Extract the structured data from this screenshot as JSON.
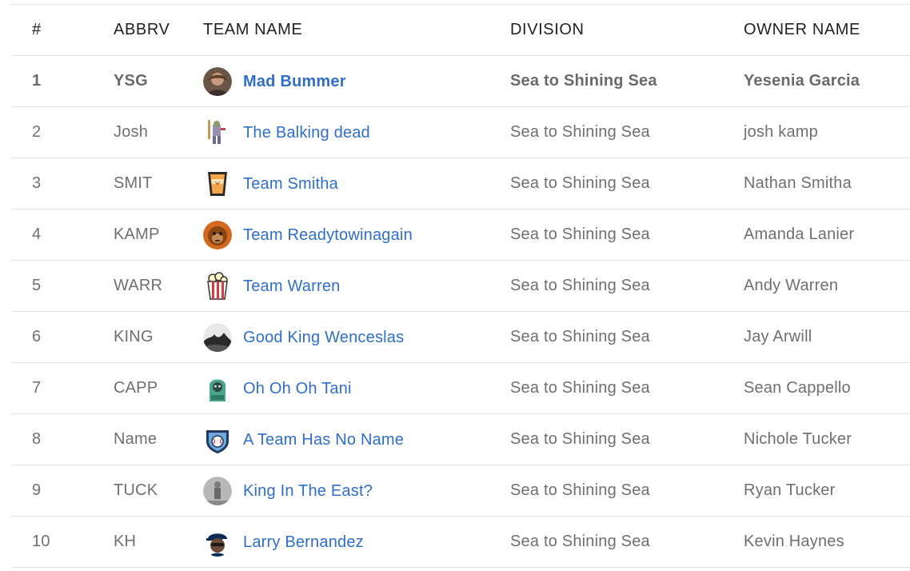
{
  "columns": {
    "rank": "#",
    "abbrv": "ABBRV",
    "team_name": "TEAM NAME",
    "division": "DIVISION",
    "owner_name": "OWNER NAME"
  },
  "colors": {
    "link": "#2f6fc6",
    "text": "#6f6f6f",
    "header_text": "#222222",
    "divider": "#e6e6e6"
  },
  "rows": [
    {
      "rank": "1",
      "abbr": "YSG",
      "team": "Mad Bummer",
      "division": "Sea to Shining Sea",
      "owner": "Yesenia Garcia",
      "avatar": "photo-avatar"
    },
    {
      "rank": "2",
      "abbr": "Josh",
      "team": "The Balking dead",
      "division": "Sea to Shining Sea",
      "owner": "josh kamp",
      "avatar": "zombie-avatar"
    },
    {
      "rank": "3",
      "abbr": "SMIT",
      "team": "Team Smitha",
      "division": "Sea to Shining Sea",
      "owner": "Nathan Smitha",
      "avatar": "cup-avatar"
    },
    {
      "rank": "4",
      "abbr": "KAMP",
      "team": "Team Readytowinagain",
      "division": "Sea to Shining Sea",
      "owner": "Amanda Lanier",
      "avatar": "ape-avatar"
    },
    {
      "rank": "5",
      "abbr": "WARR",
      "team": "Team Warren",
      "division": "Sea to Shining Sea",
      "owner": "Andy Warren",
      "avatar": "popcorn-avatar"
    },
    {
      "rank": "6",
      "abbr": "KING",
      "team": "Good King Wenceslas",
      "division": "Sea to Shining Sea",
      "owner": "Jay Arwill",
      "avatar": "photo-avatar"
    },
    {
      "rank": "7",
      "abbr": "CAPP",
      "team": "Oh Oh Oh Tani",
      "division": "Sea to Shining Sea",
      "owner": "Sean Cappello",
      "avatar": "hoodie-avatar"
    },
    {
      "rank": "8",
      "abbr": "Name",
      "team": "A Team Has No Name",
      "division": "Sea to Shining Sea",
      "owner": "Nichole Tucker",
      "avatar": "baseball-badge-avatar"
    },
    {
      "rank": "9",
      "abbr": "TUCK",
      "team": "King In The East?",
      "division": "Sea to Shining Sea",
      "owner": "Ryan Tucker",
      "avatar": "photo-avatar"
    },
    {
      "rank": "10",
      "abbr": "KH",
      "team": "Larry Bernandez",
      "division": "Sea to Shining Sea",
      "owner": "Kevin Haynes",
      "avatar": "player-avatar"
    }
  ]
}
